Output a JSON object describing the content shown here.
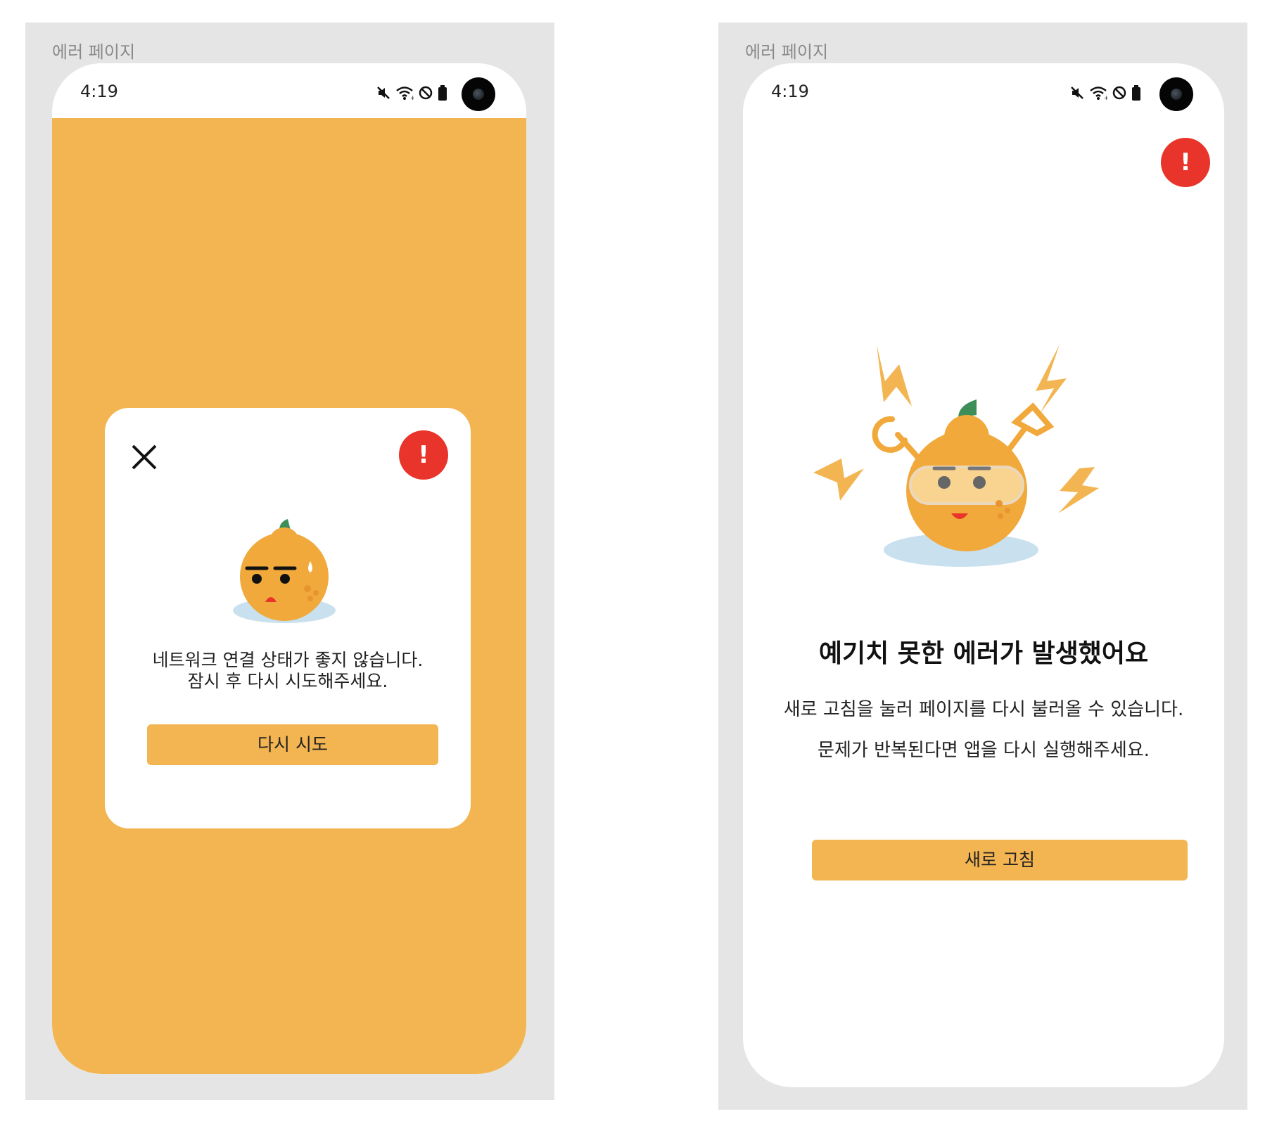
{
  "left": {
    "caption": "에러 페이지",
    "status": {
      "time": "4:19"
    },
    "dialog": {
      "message_line1": "네트워크 연결 상태가 좋지 않습니다.",
      "message_line2": "잠시 후 다시 시도해주세요.",
      "retry_label": "다시 시도",
      "alert_glyph": "!"
    }
  },
  "right": {
    "caption": "에러 페이지",
    "status": {
      "time": "4:19"
    },
    "alert_glyph": "!",
    "title": "예기치 못한 에러가 발생했어요",
    "desc_line1": "새로 고침을 눌러 페이지를 다시 불러올 수 있습니다.",
    "desc_line2": "문제가 반복된다면 앱을 다시 실행해주세요.",
    "refresh_label": "새로 고침"
  },
  "colors": {
    "accent": "#f3b552",
    "alert": "#e8342a",
    "mascot_body": "#f0a93a",
    "leaf": "#3e8e5a",
    "puddle": "#c9e1ef"
  },
  "icons": [
    "mute-icon",
    "wifi-icon",
    "dnd-icon",
    "battery-icon",
    "camera-icon",
    "close-icon",
    "alert-icon"
  ]
}
